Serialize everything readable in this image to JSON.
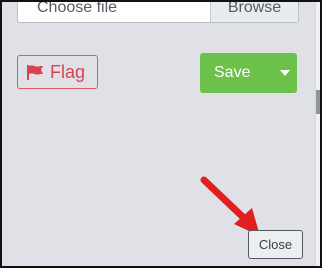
{
  "file_input": {
    "placeholder": "Choose file",
    "browse_label": "Browse"
  },
  "flag_button": {
    "label": "Flag",
    "icon": "flag-icon",
    "color": "#d9434f"
  },
  "save_button": {
    "label": "Save",
    "icon": "caret-down-icon",
    "color": "#6cc14a"
  },
  "close_button": {
    "label": "Close"
  },
  "annotation": {
    "icon": "red-arrow-icon",
    "color": "#e0201e"
  }
}
